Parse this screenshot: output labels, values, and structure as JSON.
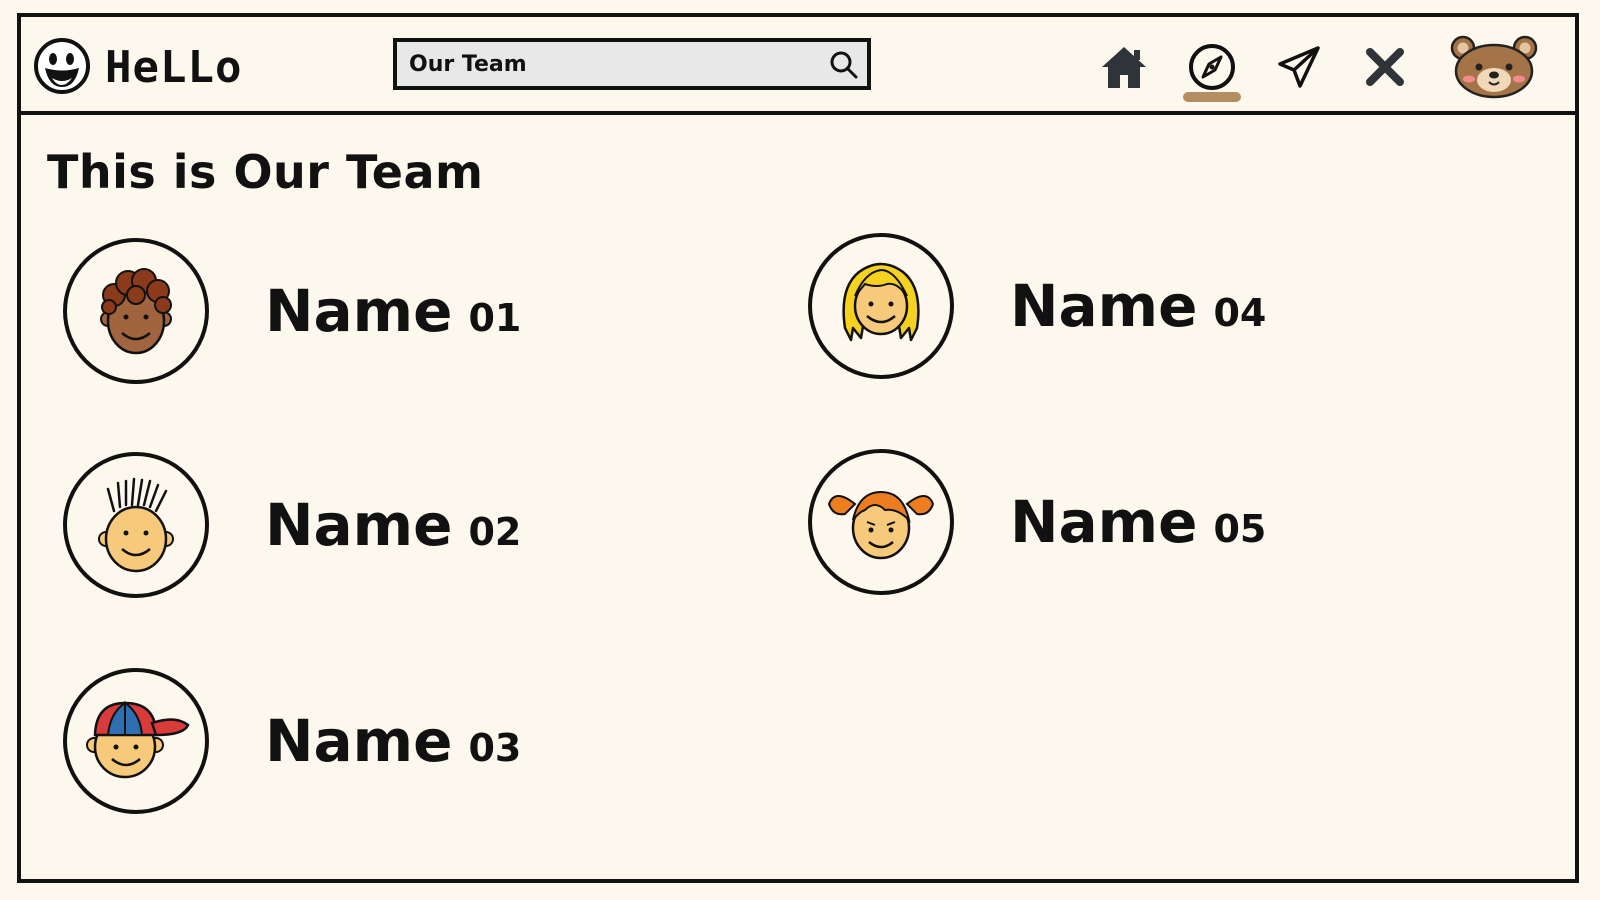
{
  "header": {
    "logo_text": "HeLLo",
    "search": {
      "value": "Our Team"
    },
    "nav": [
      {
        "icon": "home-icon"
      },
      {
        "icon": "compass-icon",
        "active": true
      },
      {
        "icon": "send-icon"
      },
      {
        "icon": "close-icon"
      }
    ],
    "profile_icon": "bear-avatar-icon",
    "accent_color": "#b58d62"
  },
  "main": {
    "title": "This is Our Team",
    "members": [
      {
        "label": "Name",
        "number": "01",
        "avatar": "curly-haired-boy-icon"
      },
      {
        "label": "Name",
        "number": "02",
        "avatar": "spiky-haired-boy-icon"
      },
      {
        "label": "Name",
        "number": "03",
        "avatar": "cap-boy-icon"
      },
      {
        "label": "Name",
        "number": "04",
        "avatar": "blonde-girl-icon"
      },
      {
        "label": "Name",
        "number": "05",
        "avatar": "pigtail-girl-icon"
      }
    ]
  }
}
